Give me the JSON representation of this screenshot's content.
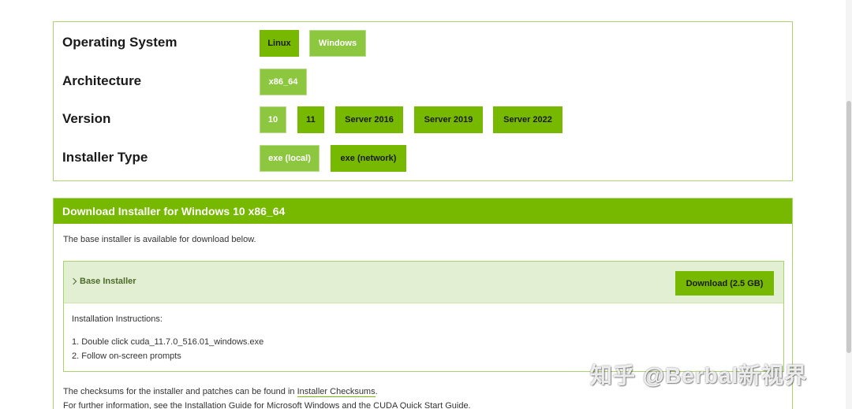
{
  "selector": {
    "rows": [
      {
        "label": "Operating System",
        "options": [
          "Linux",
          "Windows"
        ]
      },
      {
        "label": "Architecture",
        "options": [
          "x86_64"
        ]
      },
      {
        "label": "Version",
        "options": [
          "10",
          "11",
          "Server 2016",
          "Server 2019",
          "Server 2022"
        ]
      },
      {
        "label": "Installer Type",
        "options": [
          "exe (local)",
          "exe (network)"
        ]
      }
    ],
    "selected": {
      "os": "Windows",
      "arch": "x86_64",
      "version": "10",
      "installer_type": "exe (local)"
    }
  },
  "download": {
    "header": "Download Installer for Windows 10 x86_64",
    "description": "The base installer is available for download below.",
    "base_installer_label": "Base Installer",
    "download_button": "Download (2.5 GB)",
    "instructions_title": "Installation Instructions:",
    "steps": [
      "1. Double click cuda_11.7.0_516.01_windows.exe",
      "2. Follow on-screen prompts"
    ],
    "checksum_prefix": "The checksums for the installer and patches can be found in ",
    "checksum_link": "Installer Checksums",
    "checksum_suffix": ".",
    "further_info": "For further information, see the Installation Guide for Microsoft Windows and the CUDA Quick Start Guide."
  },
  "watermark": "知乎 @Berbal新视界",
  "colors": {
    "accent": "#76b900",
    "accent_light": "#8dc63f",
    "panel_border": "#a9d46b",
    "installer_head_bg": "#e3efd3"
  }
}
